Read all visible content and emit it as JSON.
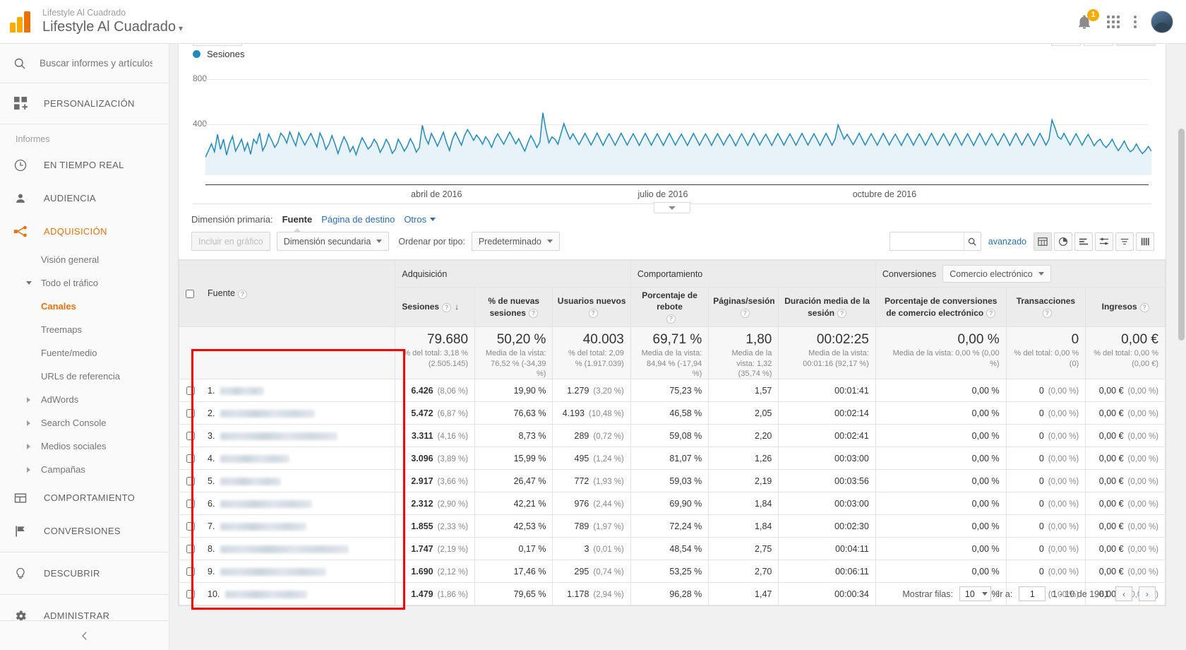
{
  "header": {
    "account_sup": "Lifestyle Al Cuadrado",
    "account_name": "Lifestyle Al Cuadrado",
    "account_caret": "▾",
    "notification_count": "1"
  },
  "sidebar": {
    "search_placeholder": "Buscar informes y artículos",
    "search_value": "",
    "personalization": "PERSONALIZACIÓN",
    "reports_label": "Informes",
    "items": [
      {
        "label": "EN TIEMPO REAL",
        "icon": "clock-icon"
      },
      {
        "label": "AUDIENCIA",
        "icon": "person-icon"
      },
      {
        "label": "ADQUISICIÓN",
        "icon": "acquisition-icon",
        "active": true
      },
      {
        "label": "COMPORTAMIENTO",
        "icon": "behavior-icon"
      },
      {
        "label": "CONVERSIONES",
        "icon": "flag-icon"
      },
      {
        "label": "DESCUBRIR",
        "icon": "bulb-icon"
      },
      {
        "label": "ADMINISTRAR",
        "icon": "gear-icon"
      }
    ],
    "sub_items": [
      {
        "label": "Visión general",
        "arrow": "none"
      },
      {
        "label": "Todo el tráfico",
        "arrow": "down"
      },
      {
        "label": "Canales",
        "arrow": "none",
        "selected": true
      },
      {
        "label": "Treemaps",
        "arrow": "none"
      },
      {
        "label": "Fuente/medio",
        "arrow": "none"
      },
      {
        "label": "URLs de referencia",
        "arrow": "none"
      },
      {
        "label": "AdWords",
        "arrow": "right"
      },
      {
        "label": "Search Console",
        "arrow": "right"
      },
      {
        "label": "Medios sociales",
        "arrow": "right"
      },
      {
        "label": "Campañas",
        "arrow": "right"
      }
    ]
  },
  "chart_data": {
    "type": "line",
    "title": "",
    "legend": [
      "Sesiones"
    ],
    "legend_position": "top-left",
    "series": [
      {
        "name": "Sesiones",
        "color": "#1f8ac0",
        "values": [
          150,
          205,
          262,
          195,
          340,
          215,
          300,
          168,
          262,
          325,
          200,
          248,
          300,
          205,
          270,
          175,
          300,
          265,
          352,
          205,
          255,
          342,
          290,
          232,
          270,
          350,
          320,
          268,
          360,
          300,
          245,
          355,
          300,
          252,
          300,
          348,
          292,
          235,
          352,
          300,
          215,
          258,
          330,
          262,
          180,
          255,
          320,
          270,
          195,
          240,
          170,
          245,
          312,
          268,
          218,
          245,
          300,
          262,
          190,
          235,
          300,
          255,
          182,
          215,
          300,
          255,
          200,
          240,
          305,
          258,
          192,
          230,
          415,
          315,
          260,
          348,
          300,
          242,
          298,
          358,
          272,
          205,
          300,
          355,
          300,
          250,
          330,
          380,
          340,
          290,
          335,
          302,
          258,
          320,
          285,
          232,
          300,
          345,
          300,
          258,
          310,
          360,
          312,
          262,
          305,
          250,
          200,
          268,
          330,
          285,
          230,
          275,
          520,
          380,
          270,
          318,
          300,
          258,
          345,
          430,
          360,
          300,
          345,
          300,
          255,
          300,
          348,
          300,
          252,
          300,
          352,
          300,
          248,
          302,
          345,
          298,
          250,
          300,
          350,
          300,
          252,
          300,
          345,
          298,
          248,
          300,
          348,
          300,
          250,
          300,
          345,
          296,
          248,
          300,
          348,
          300,
          252,
          300,
          342,
          295,
          248,
          300,
          348,
          300,
          250,
          298,
          344,
          298,
          248,
          300,
          346,
          300,
          252,
          300,
          340,
          295,
          245,
          298,
          345,
          298,
          248,
          300,
          348,
          302,
          252,
          300,
          342,
          296,
          248,
          300,
          346,
          300,
          250,
          300,
          344,
          298,
          250,
          300,
          348,
          300,
          252,
          300,
          345,
          298,
          248,
          300,
          348,
          300,
          250,
          300,
          420,
          360,
          300,
          340,
          300,
          255,
          300,
          350,
          300,
          252,
          300,
          345,
          298,
          250,
          300,
          348,
          300,
          252,
          300,
          342,
          296,
          248,
          300,
          346,
          300,
          250,
          300,
          344,
          298,
          250,
          300,
          348,
          300,
          252,
          300,
          345,
          298,
          248,
          300,
          348,
          300,
          250,
          300,
          345,
          296,
          248,
          300,
          348,
          300,
          252,
          300,
          345,
          300,
          250,
          298,
          346,
          300,
          248,
          300,
          348,
          300,
          252,
          300,
          344,
          296,
          248,
          300,
          348,
          300,
          250,
          300,
          460,
          395,
          320,
          300,
          348,
          300,
          252,
          300,
          345,
          298,
          250,
          300,
          340,
          295,
          245,
          280,
          300,
          255,
          230,
          262,
          300,
          245,
          205,
          240,
          285,
          230,
          195,
          215,
          260,
          215,
          180,
          205,
          240,
          200
        ]
      }
    ],
    "ylim": [
      0,
      800
    ],
    "yticks": [
      400,
      800
    ],
    "ylabel": "",
    "xlabel": "",
    "xtick_labels": [
      "abril de 2016",
      "julio de 2016",
      "octubre de 2016"
    ],
    "grid": true,
    "fill": true,
    "fill_color": "#e7f3f9"
  },
  "dimension_row": {
    "label": "Dimensión primaria:",
    "primary": "Fuente",
    "links": [
      "Página de destino"
    ],
    "others": "Otros"
  },
  "toolbar": {
    "include_in_chart": "Incluir en gráfico",
    "secondary_dimension": "Dimensión secundaria",
    "sort_label": "Ordenar por tipo:",
    "sort_value": "Predeterminado",
    "search_value": "",
    "advanced": "avanzado",
    "view_icons": [
      "table-view-icon",
      "pie-view-icon",
      "performance-view-icon",
      "comparison-view-icon",
      "terms-view-icon",
      "pivot-view-icon"
    ]
  },
  "table": {
    "groups": [
      {
        "label": "Adquisición",
        "span": 3
      },
      {
        "label": "Comportamiento",
        "span": 3
      },
      {
        "label": "Conversiones",
        "span": 3,
        "select": "Comercio electrónico"
      }
    ],
    "dimension_header": "Fuente",
    "columns": [
      "Sesiones",
      "% de nuevas sesiones",
      "Usuarios nuevos",
      "Porcentaje de rebote",
      "Páginas/sesión",
      "Duración media de la sesión",
      "Porcentaje de conversiones de comercio electrónico",
      "Transacciones",
      "Ingresos"
    ],
    "sorted_column": "Sesiones",
    "sort_arrow": "↓",
    "summary": [
      {
        "value": "79.680",
        "sub": "% del total: 3,18 % (2.505.145)"
      },
      {
        "value": "50,20 %",
        "sub": "Media de la vista: 76,52 % (-34,39 %)"
      },
      {
        "value": "40.003",
        "sub": "% del total: 2,09 % (1.917.039)"
      },
      {
        "value": "69,71 %",
        "sub": "Media de la vista: 84,94 % (-17,94 %)"
      },
      {
        "value": "1,80",
        "sub": "Media de la vista: 1,32 (35,74 %)"
      },
      {
        "value": "00:02:25",
        "sub": "Media de la vista: 00:01:16 (92,17 %)"
      },
      {
        "value": "0,00 %",
        "sub": "Media de la vista: 0,00 % (0,00 %)"
      },
      {
        "value": "0",
        "sub": "% del total: 0,00 % (0)"
      },
      {
        "value": "0,00 €",
        "sub": "% del total: 0,00 % (0,00 €)"
      }
    ],
    "rows": [
      {
        "index": "1.",
        "label_width": 62,
        "sessions": "6.426",
        "sessions_pct": "(8,06 %)",
        "new_sessions_pct": "19,90 %",
        "new_users": "1.279",
        "new_users_pct": "(3,20 %)",
        "bounce": "75,23 %",
        "pages": "1,57",
        "duration": "00:01:41",
        "conv": "0,00 %",
        "trans": "0",
        "trans_pct": "(0,00 %)",
        "revenue": "0,00 €",
        "revenue_pct": "(0,00 %)"
      },
      {
        "index": "2.",
        "label_width": 134,
        "sessions": "5.472",
        "sessions_pct": "(6,87 %)",
        "new_sessions_pct": "76,63 %",
        "new_users": "4.193",
        "new_users_pct": "(10,48 %)",
        "bounce": "46,58 %",
        "pages": "2,05",
        "duration": "00:02:14",
        "conv": "0,00 %",
        "trans": "0",
        "trans_pct": "(0,00 %)",
        "revenue": "0,00 €",
        "revenue_pct": "(0,00 %)"
      },
      {
        "index": "3.",
        "label_width": 166,
        "sessions": "3.311",
        "sessions_pct": "(4,16 %)",
        "new_sessions_pct": "8,73 %",
        "new_users": "289",
        "new_users_pct": "(0,72 %)",
        "bounce": "59,08 %",
        "pages": "2,20",
        "duration": "00:02:41",
        "conv": "0,00 %",
        "trans": "0",
        "trans_pct": "(0,00 %)",
        "revenue": "0,00 €",
        "revenue_pct": "(0,00 %)"
      },
      {
        "index": "4.",
        "label_width": 98,
        "sessions": "3.096",
        "sessions_pct": "(3,89 %)",
        "new_sessions_pct": "15,99 %",
        "new_users": "495",
        "new_users_pct": "(1,24 %)",
        "bounce": "81,07 %",
        "pages": "1,26",
        "duration": "00:03:00",
        "conv": "0,00 %",
        "trans": "0",
        "trans_pct": "(0,00 %)",
        "revenue": "0,00 €",
        "revenue_pct": "(0,00 %)"
      },
      {
        "index": "5.",
        "label_width": 86,
        "sessions": "2.917",
        "sessions_pct": "(3,66 %)",
        "new_sessions_pct": "26,47 %",
        "new_users": "772",
        "new_users_pct": "(1,93 %)",
        "bounce": "59,03 %",
        "pages": "2,19",
        "duration": "00:03:56",
        "conv": "0,00 %",
        "trans": "0",
        "trans_pct": "(0,00 %)",
        "revenue": "0,00 €",
        "revenue_pct": "(0,00 %)"
      },
      {
        "index": "6.",
        "label_width": 130,
        "sessions": "2.312",
        "sessions_pct": "(2,90 %)",
        "new_sessions_pct": "42,21 %",
        "new_users": "976",
        "new_users_pct": "(2,44 %)",
        "bounce": "69,90 %",
        "pages": "1,84",
        "duration": "00:03:00",
        "conv": "0,00 %",
        "trans": "0",
        "trans_pct": "(0,00 %)",
        "revenue": "0,00 €",
        "revenue_pct": "(0,00 %)"
      },
      {
        "index": "7.",
        "label_width": 122,
        "sessions": "1.855",
        "sessions_pct": "(2,33 %)",
        "new_sessions_pct": "42,53 %",
        "new_users": "789",
        "new_users_pct": "(1,97 %)",
        "bounce": "72,24 %",
        "pages": "1,84",
        "duration": "00:02:30",
        "conv": "0,00 %",
        "trans": "0",
        "trans_pct": "(0,00 %)",
        "revenue": "0,00 €",
        "revenue_pct": "(0,00 %)"
      },
      {
        "index": "8.",
        "label_width": 182,
        "sessions": "1.747",
        "sessions_pct": "(2,19 %)",
        "new_sessions_pct": "0,17 %",
        "new_users": "3",
        "new_users_pct": "(0,01 %)",
        "bounce": "48,54 %",
        "pages": "2,75",
        "duration": "00:04:11",
        "conv": "0,00 %",
        "trans": "0",
        "trans_pct": "(0,00 %)",
        "revenue": "0,00 €",
        "revenue_pct": "(0,00 %)"
      },
      {
        "index": "9.",
        "label_width": 150,
        "sessions": "1.690",
        "sessions_pct": "(2,12 %)",
        "new_sessions_pct": "17,46 %",
        "new_users": "295",
        "new_users_pct": "(0,74 %)",
        "bounce": "53,25 %",
        "pages": "2,70",
        "duration": "00:06:11",
        "conv": "0,00 %",
        "trans": "0",
        "trans_pct": "(0,00 %)",
        "revenue": "0,00 €",
        "revenue_pct": "(0,00 %)"
      },
      {
        "index": "10.",
        "label_width": 116,
        "sessions": "1.479",
        "sessions_pct": "(1,86 %)",
        "new_sessions_pct": "79,65 %",
        "new_users": "1.178",
        "new_users_pct": "(2,94 %)",
        "bounce": "96,28 %",
        "pages": "1,47",
        "duration": "00:00:34",
        "conv": "0,00 %",
        "trans": "0",
        "trans_pct": "(0,00 %)",
        "revenue": "0,00 €",
        "revenue_pct": "(0,00 %)"
      }
    ]
  },
  "pagination": {
    "rows_label": "Mostrar filas:",
    "rows_value": "10",
    "goto_label": "Ir a:",
    "goto_value": "1",
    "range": "1 - 10 de 1961",
    "prev": "‹",
    "next": "›"
  },
  "colors": {
    "accent": "#e8710a",
    "link": "#2a6ebb",
    "chart_line": "#1f8ac0",
    "highlight_box": "#ff0000"
  }
}
